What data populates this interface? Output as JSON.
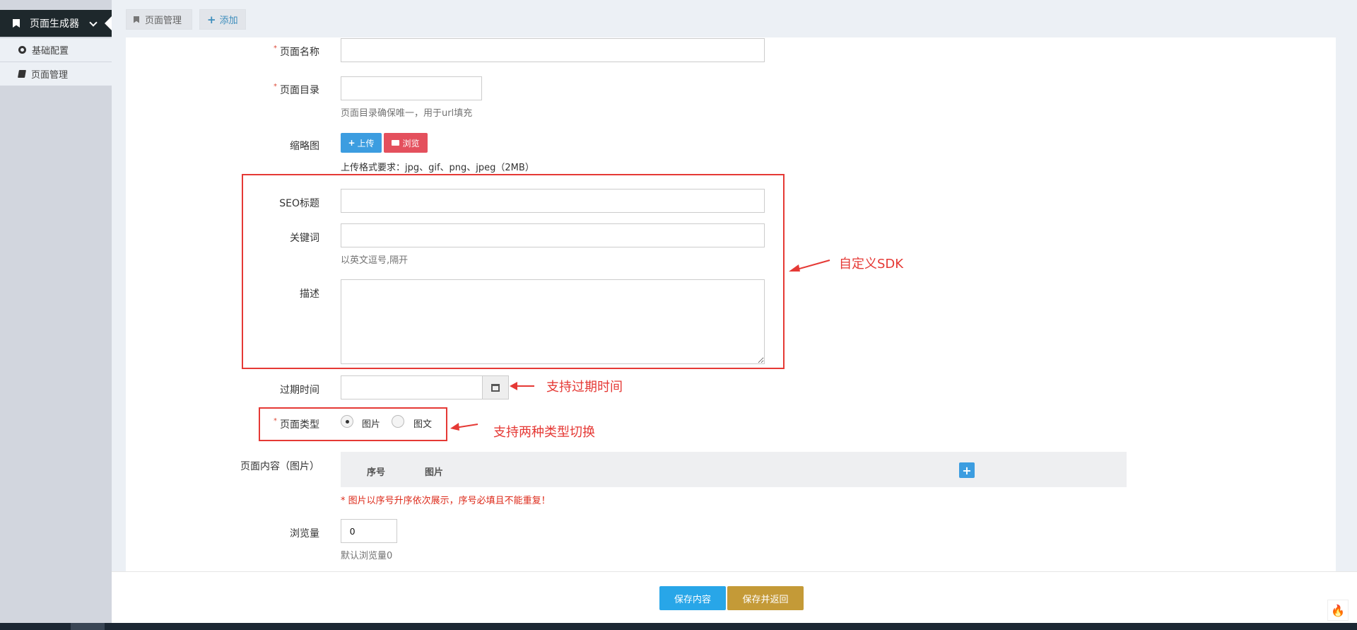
{
  "sidebar": {
    "header": "页面生成器",
    "items": [
      {
        "label": "基础配置",
        "icon": "gear-icon"
      },
      {
        "label": "页面管理",
        "icon": "book-icon"
      }
    ]
  },
  "tabs": [
    {
      "label": "页面管理",
      "icon": "bookmark-icon"
    },
    {
      "label": "添加",
      "icon": "plus-icon"
    }
  ],
  "form": {
    "page_name": {
      "label": "页面名称",
      "value": ""
    },
    "page_dir": {
      "label": "页面目录",
      "value": "",
      "help": "页面目录确保唯一，用于url填充"
    },
    "thumbnail": {
      "label": "缩略图",
      "upload_label": "上传",
      "browse_label": "浏览",
      "note": "上传格式要求：jpg、gif、png、jpeg（2MB）"
    },
    "seo_title": {
      "label": "SEO标题",
      "value": ""
    },
    "keywords": {
      "label": "关键词",
      "value": "",
      "help": "以英文逗号,隔开"
    },
    "description": {
      "label": "描述",
      "value": ""
    },
    "expire_time": {
      "label": "过期时间",
      "value": ""
    },
    "page_type": {
      "label": "页面类型",
      "options": [
        "图片",
        "图文"
      ],
      "selected": "图片"
    },
    "page_content": {
      "label": "页面内容（图片）",
      "columns": [
        "序号",
        "图片"
      ],
      "warning": "* 图片以序号升序依次展示，序号必填且不能重复！"
    },
    "views": {
      "label": "浏览量",
      "value": "0",
      "help": "默认浏览量0"
    }
  },
  "buttons": {
    "save": "保存内容",
    "save_return": "保存并返回"
  },
  "annotations": {
    "sdk": "自定义SDK",
    "expire": "支持过期时间",
    "type_switch": "支持两种类型切换"
  },
  "colors": {
    "annotation_red": "#e53935",
    "primary_blue": "#3c9de0",
    "danger_red": "#e4505d",
    "gold": "#c49a37"
  }
}
